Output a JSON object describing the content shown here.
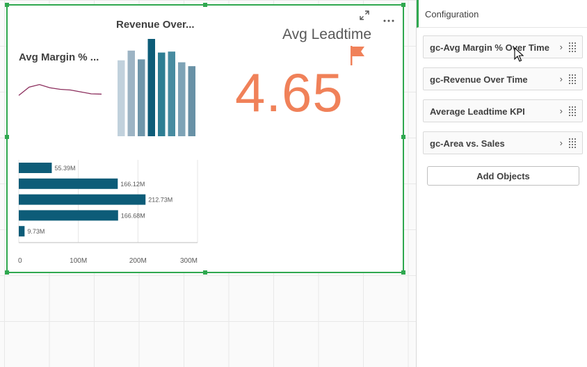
{
  "sheet": {
    "tools": {
      "expand_icon": "expand-icon",
      "more_icon": "more-icon"
    },
    "avg_margin": {
      "title": "Avg Margin % ...",
      "line_color": "#8b2d5c"
    },
    "revenue": {
      "title": "Revenue Over...",
      "bar_colors": [
        "#c1d1dc",
        "#9db4c4",
        "#6f96aa",
        "#0d5c78",
        "#2d7d93",
        "#478ba0",
        "#7ea3b6",
        "#6891a6"
      ]
    },
    "kpi": {
      "title": "Avg Leadtime",
      "value": "4.65",
      "color": "#f08159",
      "flag_icon": "flag-icon"
    }
  },
  "chart_data": [
    {
      "type": "line",
      "title": "Avg Margin % ...",
      "values": [
        0.32,
        0.58,
        0.66,
        0.56,
        0.51,
        0.49,
        0.43,
        0.37,
        0.36
      ]
    },
    {
      "type": "bar",
      "title": "Revenue Over...",
      "values": [
        0.78,
        0.88,
        0.79,
        1.0,
        0.86,
        0.87,
        0.76,
        0.72
      ]
    },
    {
      "type": "bar",
      "orientation": "horizontal",
      "values": [
        55.39,
        166.12,
        212.73,
        166.68,
        9.73
      ],
      "data_labels": [
        "55.39M",
        "166.12M",
        "212.73M",
        "166.68M",
        "9.73M"
      ],
      "xlim": [
        0,
        300
      ],
      "x_ticks": [
        "0",
        "100M",
        "200M",
        "300M"
      ],
      "color": "#0d5c78"
    }
  ],
  "panel": {
    "header": "Configuration",
    "objects": [
      {
        "label": "gc-Avg Margin % Over Time"
      },
      {
        "label": "gc-Revenue Over Time"
      },
      {
        "label": "Average Leadtime KPI"
      },
      {
        "label": "gc-Area vs. Sales"
      }
    ],
    "add_objects_label": "Add Objects"
  }
}
